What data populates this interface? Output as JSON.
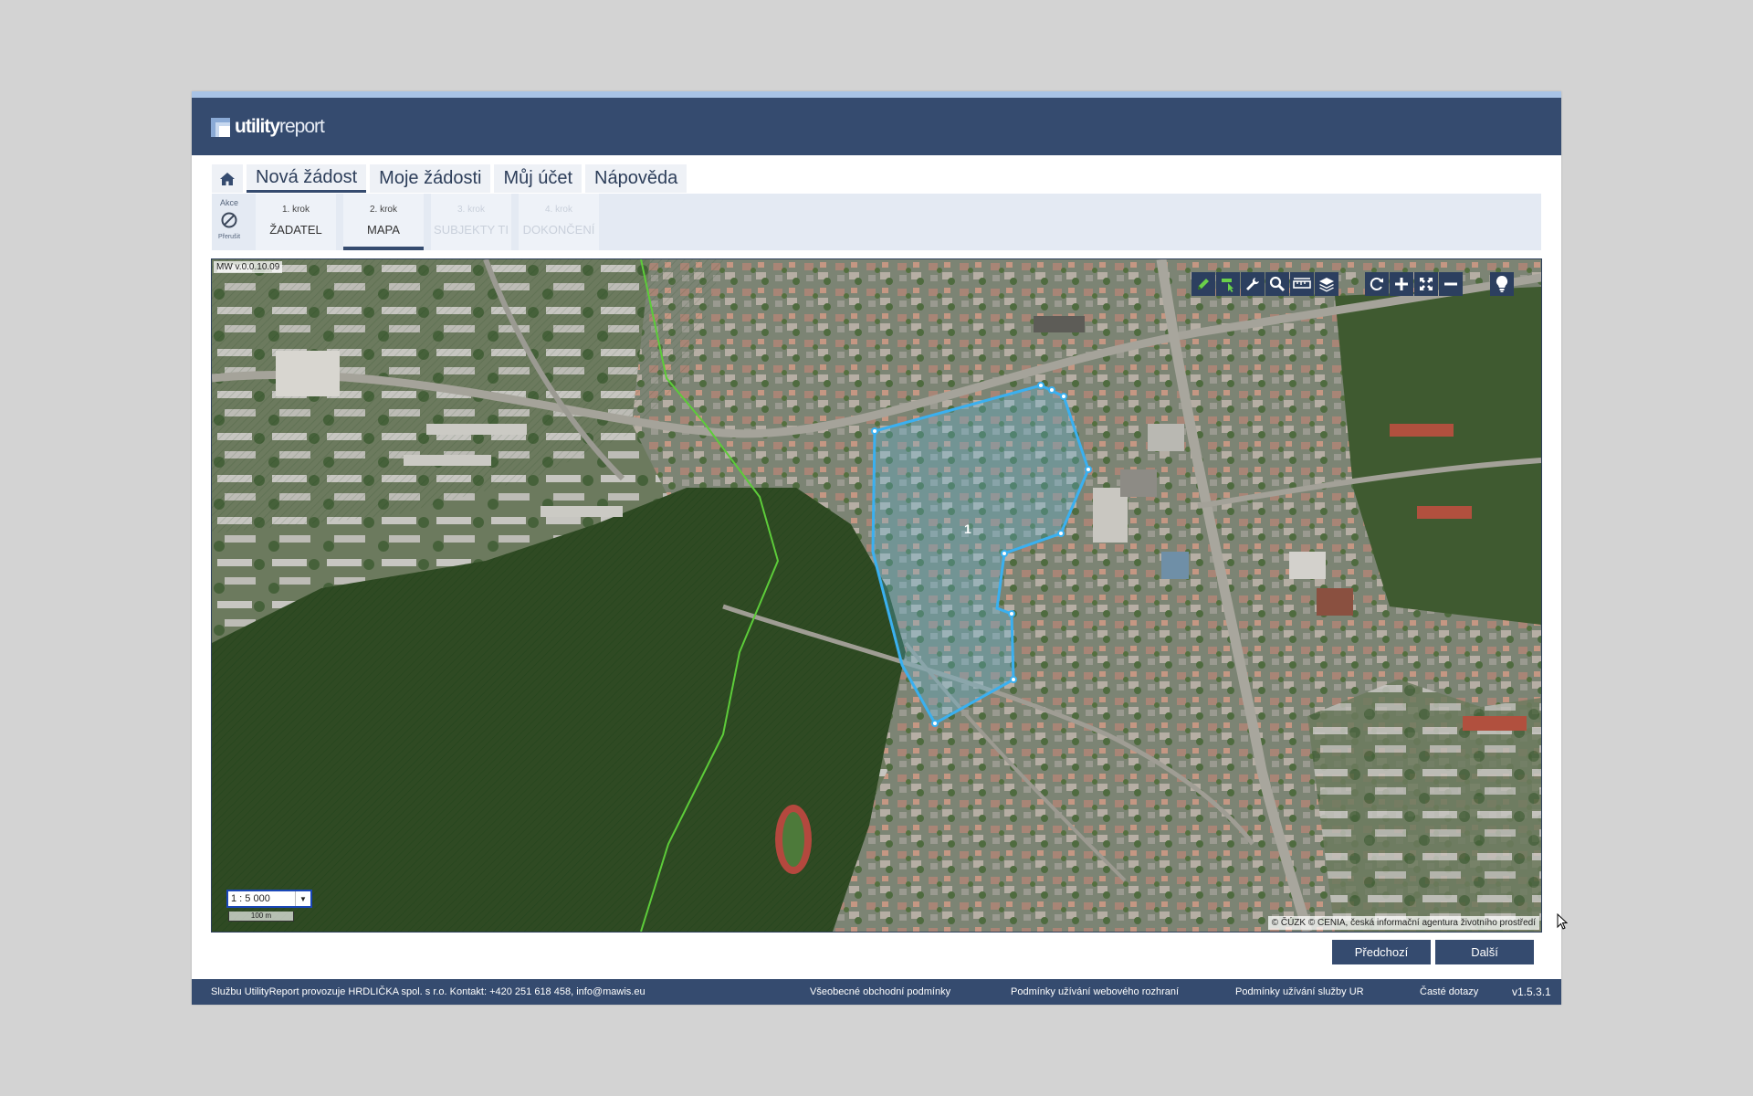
{
  "app": {
    "logo_bold": "utility",
    "logo_light": "report"
  },
  "nav": {
    "home_icon": "home-icon",
    "tabs": [
      {
        "label": "Nová žádost",
        "active": true
      },
      {
        "label": "Moje žádosti"
      },
      {
        "label": "Můj účet"
      },
      {
        "label": "Nápověda"
      }
    ]
  },
  "actions": {
    "label": "Akce",
    "cancel_label": "Přerušit",
    "cancel_icon": "cancel-icon"
  },
  "steps": [
    {
      "num": "1. krok",
      "name": "ŽADATEL",
      "state": "done"
    },
    {
      "num": "2. krok",
      "name": "MAPA",
      "state": "active"
    },
    {
      "num": "3. krok",
      "name": "SUBJEKTY TI",
      "state": "disabled"
    },
    {
      "num": "4. krok",
      "name": "DOKONČENÍ",
      "state": "disabled"
    }
  ],
  "map": {
    "version": "MW v.0.0.10.09",
    "polygon_label": "1",
    "scale_value": "1 : 5 000",
    "scalebar_label": "100 m",
    "attribution": "© ČÚZK © CENIA, česká informační agentura životního prostředí",
    "toolbar": [
      "draw-pencil-icon",
      "select-edit-icon",
      "wrench-icon",
      "zoom-search-icon",
      "measure-ruler-icon",
      "layers-icon",
      "refresh-icon",
      "zoom-in-icon",
      "fullscreen-icon",
      "zoom-out-icon",
      "lightbulb-icon"
    ],
    "colors": {
      "polygon": "#3ab0f0",
      "protected_area": "#5dcc3a"
    }
  },
  "buttons": {
    "previous": "Předchozí",
    "next": "Další"
  },
  "footer": {
    "operator": "Službu UtilityReport provozuje HRDLIČKA spol. s r.o. Kontakt: +420 251 618 458, info@mawis.eu",
    "terms": "Všeobecné obchodní podmínky",
    "web_terms": "Podmínky užívání webového rozhraní",
    "service_terms": "Podmínky užívání služby UR",
    "faq": "Časté dotazy",
    "version": "v1.5.3.1"
  }
}
